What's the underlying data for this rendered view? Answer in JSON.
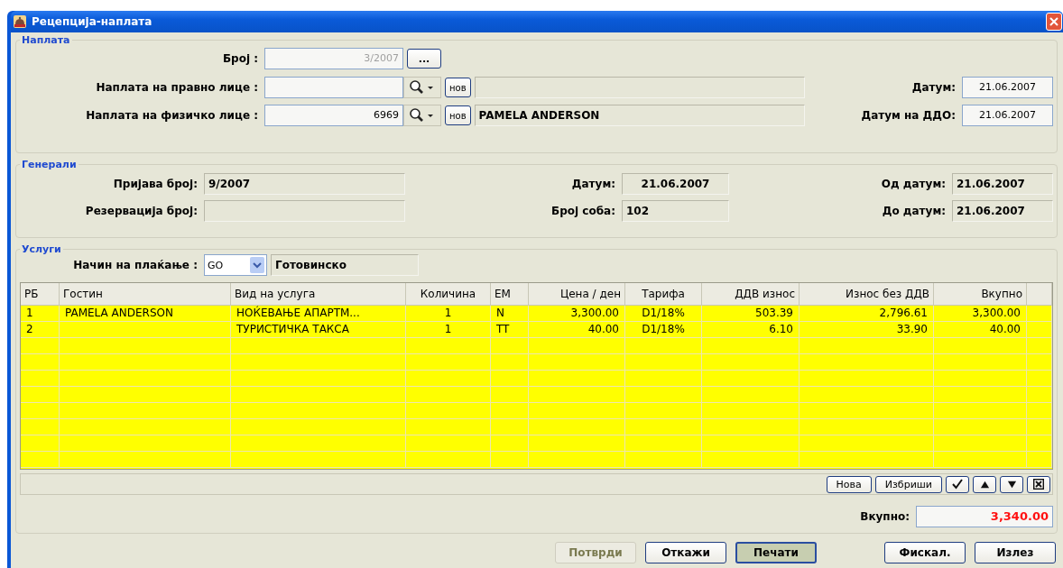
{
  "window": {
    "title": "Рецепција-наплата"
  },
  "payment": {
    "legend": "Наплата",
    "number": {
      "label": "Број :",
      "value": "3/2007",
      "disabled": true,
      "button": "..."
    },
    "legal_entity": {
      "label": "Наплата на правно лице :",
      "new_button": "нов"
    },
    "natural_person": {
      "label": "Наплата на физичко лице :",
      "value": "6969",
      "new_button": "нов",
      "name": "PAMELA  ANDERSON"
    },
    "date": {
      "label": "Датум:",
      "value": "21.06.2007"
    },
    "ddo_date": {
      "label": "Датум на ДДО:",
      "value": "21.06.2007"
    }
  },
  "general": {
    "legend": "Генерали",
    "registration": {
      "label": "Пријава број:",
      "value": "9/2007"
    },
    "reservation": {
      "label": "Резервација број:"
    },
    "date": {
      "label": "Датум:",
      "value": "21.06.2007"
    },
    "room": {
      "label": "Број соба:",
      "value": "102"
    },
    "from_date": {
      "label": "Од датум:",
      "value": "21.06.2007"
    },
    "to_date": {
      "label": "До датум:",
      "value": "21.06.2007"
    }
  },
  "services": {
    "legend": "Услуги",
    "payment_method": {
      "label": "Начин на плаќање :",
      "code": "GO",
      "name": "Готовинско"
    },
    "table": {
      "columns": [
        "РБ",
        "Гостин",
        "Вид на услуга",
        "Количина",
        "ЕМ",
        "Цена / ден",
        "Тарифа",
        "ДДВ износ",
        "Износ без ДДВ",
        "Вкупно"
      ],
      "rows": [
        [
          "1",
          "PAMELA  ANDERSON",
          "НОЌЕВАЊЕ АПАРТМ...",
          "1",
          "N",
          "3,300.00",
          "D1/18%",
          "503.39",
          "2,796.61",
          "3,300.00"
        ],
        [
          "2",
          "",
          "ТУРИСТИЧКА ТАКСА",
          "1",
          "TT",
          "40.00",
          "D1/18%",
          "6.10",
          "33.90",
          "40.00"
        ]
      ]
    },
    "row_buttons": [
      "Нова",
      "Избриши"
    ],
    "total": {
      "label": "Вкупно:",
      "value": "3,340.00"
    }
  },
  "buttons_left": [
    {
      "label": "Потврди",
      "disabled": true,
      "default": false
    },
    {
      "label": "Откажи",
      "disabled": false,
      "default": false
    },
    {
      "label": "Печати",
      "disabled": false,
      "default": true
    }
  ],
  "buttons_right": [
    {
      "label": "Фискал.",
      "disabled": false,
      "default": false
    },
    {
      "label": "Излез",
      "disabled": false,
      "default": false
    }
  ]
}
